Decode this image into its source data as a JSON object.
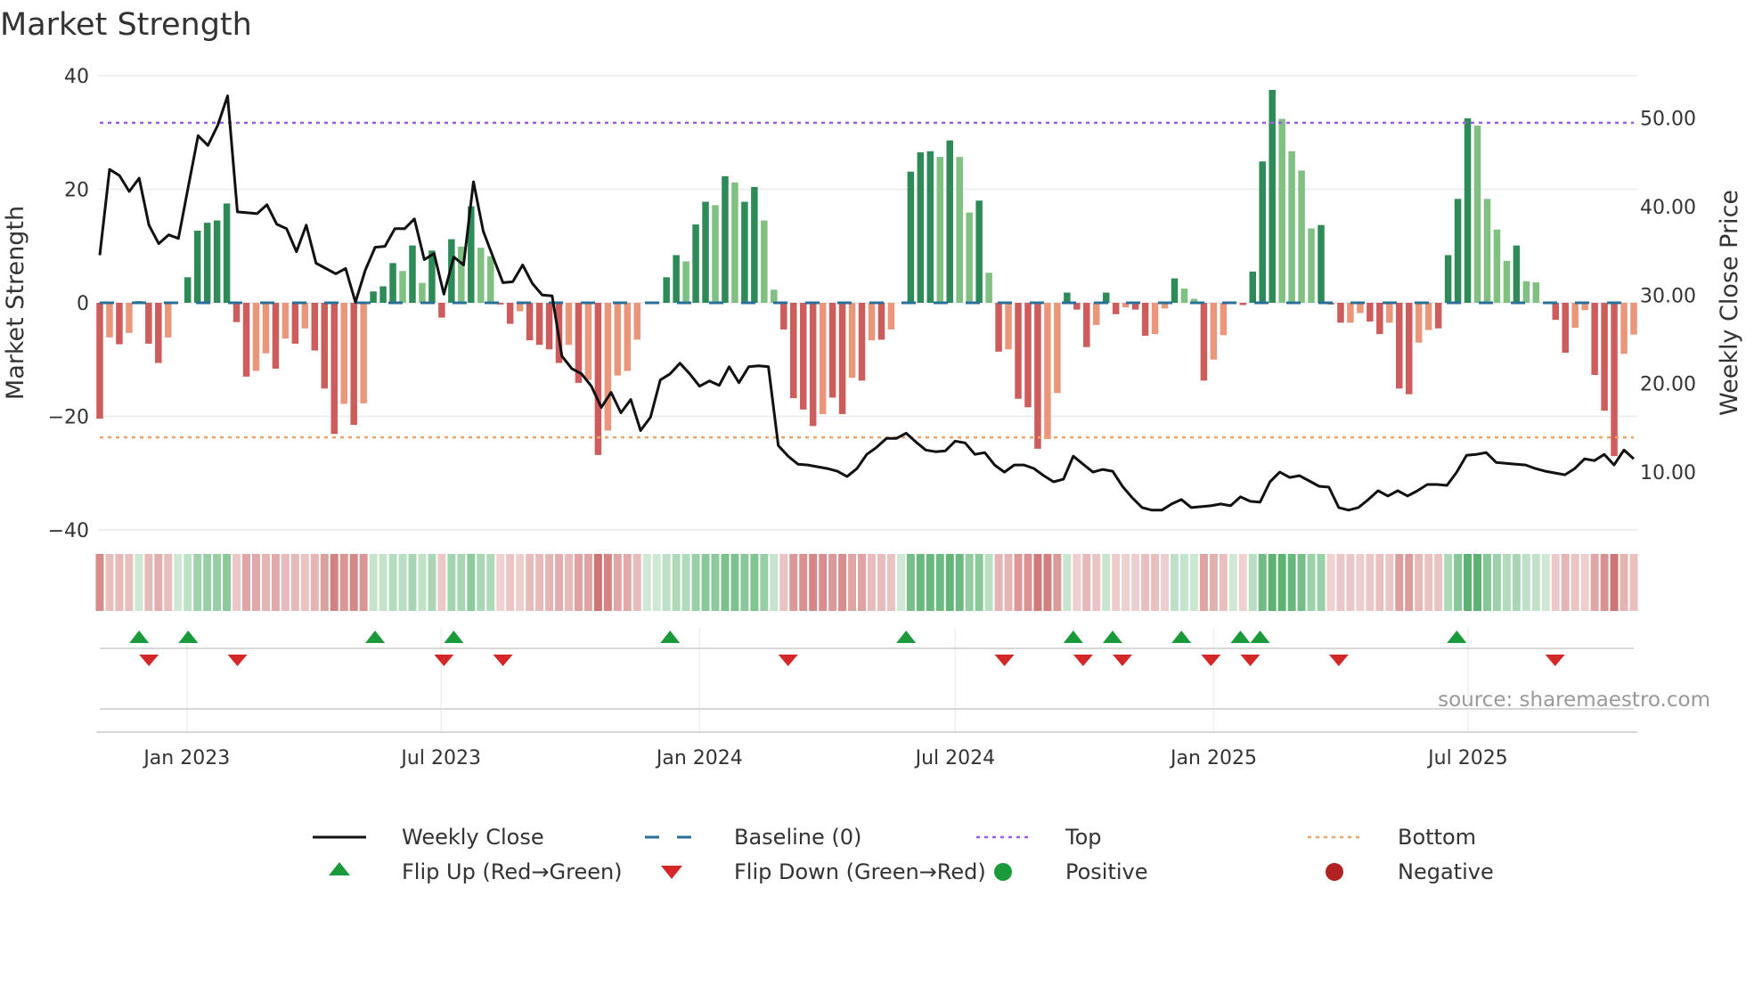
{
  "chart_data": {
    "type": "bar",
    "title": "Market Strength",
    "ylabel": "Market Strength",
    "y2label": "Weekly Close Price",
    "ylim": [
      -40,
      40
    ],
    "y2lim": [
      3.5,
      54.8
    ],
    "yticks": [
      40,
      20,
      0,
      -20,
      -40
    ],
    "ytick_labels": [
      "40",
      "20",
      "0",
      "−20",
      "−40"
    ],
    "y2ticks": [
      50,
      40,
      30,
      20,
      10
    ],
    "y2tick_labels": [
      "50.00",
      "40.00",
      "30.00",
      "20.00",
      "10.00"
    ],
    "xrange": [
      "2022-10-31",
      "2025-10-27"
    ],
    "xticks": [
      {
        "date": "2023-01-01",
        "label": "Jan 2023"
      },
      {
        "date": "2023-07-01",
        "label": "Jul 2023"
      },
      {
        "date": "2024-01-01",
        "label": "Jan 2024"
      },
      {
        "date": "2024-07-01",
        "label": "Jul 2024"
      },
      {
        "date": "2025-01-01",
        "label": "Jan 2025"
      },
      {
        "date": "2025-07-01",
        "label": "Jul 2025"
      }
    ],
    "grid": true,
    "thresholds": {
      "top": 31.7,
      "bottom": -23.7,
      "baseline": 0
    },
    "colors": {
      "pos_strong": "#2e8b57",
      "pos_weak": "#80c080",
      "neg_strong": "#cd5c5c",
      "neg_weak": "#e9967a",
      "baseline": "#2a6f97",
      "top": "#9b5de5",
      "bottom": "#f4a261",
      "line": "#111111",
      "flip_up": "#1a9a3a",
      "flip_down": "#d62728",
      "positive": "#1a9a3a",
      "negative": "#b22222"
    },
    "strength": [
      [
        -20.4,
        "s"
      ],
      [
        -6.1,
        "w"
      ],
      [
        -7.3,
        "s"
      ],
      [
        -5.3,
        "w"
      ],
      [
        0.3,
        "s"
      ],
      [
        -7.2,
        "s"
      ],
      [
        -10.6,
        "s"
      ],
      [
        -6.1,
        "w"
      ],
      [
        0,
        "s"
      ],
      [
        4.5,
        "s"
      ],
      [
        12.7,
        "s"
      ],
      [
        14.1,
        "s"
      ],
      [
        14.5,
        "s"
      ],
      [
        17.5,
        "s"
      ],
      [
        -3.4,
        "s"
      ],
      [
        -13,
        "s"
      ],
      [
        -12,
        "w"
      ],
      [
        -8.9,
        "w"
      ],
      [
        -11.6,
        "s"
      ],
      [
        -6.3,
        "w"
      ],
      [
        -7.2,
        "s"
      ],
      [
        -4.5,
        "w"
      ],
      [
        -8.4,
        "s"
      ],
      [
        -15.1,
        "s"
      ],
      [
        -23.1,
        "s"
      ],
      [
        -17.8,
        "w"
      ],
      [
        -21.5,
        "s"
      ],
      [
        -17.7,
        "w"
      ],
      [
        2,
        "s"
      ],
      [
        2.9,
        "s"
      ],
      [
        7,
        "s"
      ],
      [
        5.6,
        "w"
      ],
      [
        10.1,
        "s"
      ],
      [
        3.5,
        "w"
      ],
      [
        9.2,
        "s"
      ],
      [
        -2.6,
        "s"
      ],
      [
        11.2,
        "s"
      ],
      [
        9.9,
        "w"
      ],
      [
        17,
        "s"
      ],
      [
        9.7,
        "w"
      ],
      [
        8.2,
        "w"
      ],
      [
        -0.3,
        "s"
      ],
      [
        -3.7,
        "s"
      ],
      [
        -1.5,
        "w"
      ],
      [
        -6.6,
        "s"
      ],
      [
        -7.4,
        "s"
      ],
      [
        -8.2,
        "s"
      ],
      [
        -10.6,
        "s"
      ],
      [
        -7.4,
        "w"
      ],
      [
        -14.1,
        "s"
      ],
      [
        -13.6,
        "w"
      ],
      [
        -26.8,
        "s"
      ],
      [
        -22.5,
        "w"
      ],
      [
        -12.8,
        "w"
      ],
      [
        -12,
        "w"
      ],
      [
        -6.5,
        "w"
      ],
      [
        0,
        "s"
      ],
      [
        0,
        "s"
      ],
      [
        4.5,
        "s"
      ],
      [
        8.4,
        "s"
      ],
      [
        7.3,
        "w"
      ],
      [
        13.8,
        "s"
      ],
      [
        17.8,
        "s"
      ],
      [
        17.2,
        "w"
      ],
      [
        22.3,
        "s"
      ],
      [
        21.2,
        "w"
      ],
      [
        17.8,
        "s"
      ],
      [
        20.4,
        "s"
      ],
      [
        14.5,
        "w"
      ],
      [
        2.3,
        "w"
      ],
      [
        -4.7,
        "s"
      ],
      [
        -16.8,
        "s"
      ],
      [
        -18.8,
        "s"
      ],
      [
        -21.7,
        "s"
      ],
      [
        -19.6,
        "w"
      ],
      [
        -16.7,
        "s"
      ],
      [
        -19.6,
        "s"
      ],
      [
        -13.2,
        "w"
      ],
      [
        -13.7,
        "s"
      ],
      [
        -6.6,
        "w"
      ],
      [
        -6.5,
        "s"
      ],
      [
        -4.7,
        "w"
      ],
      [
        0,
        "s"
      ],
      [
        23.1,
        "s"
      ],
      [
        26.5,
        "s"
      ],
      [
        26.7,
        "s"
      ],
      [
        25.7,
        "w"
      ],
      [
        28.6,
        "s"
      ],
      [
        25.7,
        "w"
      ],
      [
        15.9,
        "w"
      ],
      [
        18,
        "s"
      ],
      [
        5.3,
        "w"
      ],
      [
        -8.6,
        "s"
      ],
      [
        -8.2,
        "w"
      ],
      [
        -16.9,
        "s"
      ],
      [
        -18.4,
        "s"
      ],
      [
        -25.7,
        "s"
      ],
      [
        -24,
        "w"
      ],
      [
        -15.9,
        "w"
      ],
      [
        1.8,
        "s"
      ],
      [
        -1.2,
        "s"
      ],
      [
        -7.8,
        "s"
      ],
      [
        -3.9,
        "w"
      ],
      [
        1.8,
        "s"
      ],
      [
        -2,
        "s"
      ],
      [
        -0.8,
        "w"
      ],
      [
        -1.2,
        "s"
      ],
      [
        -5.8,
        "s"
      ],
      [
        -5.5,
        "w"
      ],
      [
        -1,
        "w"
      ],
      [
        4.3,
        "s"
      ],
      [
        2.5,
        "w"
      ],
      [
        0.7,
        "w"
      ],
      [
        -13.7,
        "s"
      ],
      [
        -10,
        "w"
      ],
      [
        -5.7,
        "w"
      ],
      [
        0,
        "s"
      ],
      [
        -0.4,
        "s"
      ],
      [
        5.5,
        "s"
      ],
      [
        24.9,
        "s"
      ],
      [
        37.5,
        "s"
      ],
      [
        32.4,
        "w"
      ],
      [
        26.7,
        "w"
      ],
      [
        23.3,
        "w"
      ],
      [
        13.1,
        "w"
      ],
      [
        13.7,
        "s"
      ],
      [
        -0.3,
        "s"
      ],
      [
        -3.5,
        "s"
      ],
      [
        -3.5,
        "w"
      ],
      [
        -1.8,
        "w"
      ],
      [
        -3.3,
        "s"
      ],
      [
        -5.5,
        "s"
      ],
      [
        -3.5,
        "w"
      ],
      [
        -15.1,
        "s"
      ],
      [
        -16.1,
        "s"
      ],
      [
        -7,
        "w"
      ],
      [
        -4.8,
        "w"
      ],
      [
        -4.5,
        "s"
      ],
      [
        8.4,
        "s"
      ],
      [
        18.3,
        "s"
      ],
      [
        32.5,
        "s"
      ],
      [
        31.2,
        "w"
      ],
      [
        18.3,
        "w"
      ],
      [
        12.9,
        "w"
      ],
      [
        7.4,
        "w"
      ],
      [
        10.1,
        "s"
      ],
      [
        3.8,
        "w"
      ],
      [
        3.6,
        "w"
      ],
      [
        0,
        "s"
      ],
      [
        -3,
        "s"
      ],
      [
        -8.8,
        "s"
      ],
      [
        -4.4,
        "w"
      ],
      [
        -1.3,
        "w"
      ],
      [
        -12.7,
        "s"
      ],
      [
        -19,
        "s"
      ],
      [
        -27,
        "s"
      ],
      [
        -9,
        "w"
      ],
      [
        -5.6,
        "w"
      ]
    ],
    "weekly_close": [
      34.5,
      44.2,
      43.5,
      41.7,
      43.2,
      37.9,
      35.8,
      36.8,
      36.4,
      42.2,
      48,
      46.9,
      49.2,
      52.5,
      39.4,
      39.3,
      39.2,
      40.2,
      38,
      37.5,
      34.9,
      37.9,
      33.6,
      33,
      32.4,
      33,
      29.2,
      32.8,
      35.4,
      35.5,
      37.5,
      37.5,
      38.6,
      34,
      34.7,
      30.1,
      34.3,
      33.4,
      42.8,
      37.2,
      34.3,
      31.4,
      31.5,
      33.4,
      31.3,
      30,
      29.9,
      23.1,
      21.7,
      21.1,
      19.7,
      17.3,
      19,
      16.7,
      18.2,
      14.7,
      16.2,
      20.4,
      21.1,
      22.3,
      21.1,
      19.7,
      20.3,
      19.8,
      21.9,
      20.1,
      21.9,
      22,
      21.9,
      13,
      11.8,
      10.9,
      10.8,
      10.6,
      10.4,
      10.1,
      9.5,
      10.4,
      12,
      12.8,
      13.8,
      13.8,
      14.4,
      13.4,
      12.5,
      12.3,
      12.4,
      13.5,
      13.3,
      12,
      12.2,
      10.8,
      10,
      10.8,
      10.8,
      10.4,
      9.6,
      8.9,
      9.2,
      11.8,
      10.9,
      10,
      10.3,
      10.1,
      8.4,
      7.1,
      6,
      5.7,
      5.7,
      6.4,
      6.9,
      6,
      6.1,
      6.2,
      6.4,
      6.2,
      7.2,
      6.7,
      6.6,
      8.9,
      10,
      9.4,
      9.6,
      9,
      8.4,
      8.3,
      6,
      5.7,
      6,
      6.9,
      7.9,
      7.3,
      7.9,
      7.3,
      7.9,
      8.6,
      8.6,
      8.5,
      10,
      11.9,
      12,
      12.2,
      11.1,
      11,
      10.9,
      10.8,
      10.4,
      10.1,
      9.9,
      9.7,
      10.4,
      11.5,
      11.3,
      12,
      10.8,
      12.5,
      11.5
    ],
    "flip_up_dates": [
      "2022-11-28",
      "2023-01-02",
      "2023-05-15",
      "2023-07-10",
      "2023-12-11",
      "2024-05-27",
      "2024-09-23",
      "2024-10-21",
      "2024-12-09",
      "2025-01-20",
      "2025-02-03",
      "2025-06-23"
    ],
    "flip_down_dates": [
      "2022-12-05",
      "2023-02-06",
      "2023-07-03",
      "2023-08-14",
      "2024-03-04",
      "2024-08-05",
      "2024-09-30",
      "2024-10-28",
      "2024-12-30",
      "2025-01-27",
      "2025-03-31",
      "2025-09-01"
    ],
    "legend": {
      "placement": "bottom",
      "items": [
        {
          "label": "Weekly Close",
          "symbol": "line"
        },
        {
          "label": "Baseline (0)",
          "symbol": "dash"
        },
        {
          "label": "Top",
          "symbol": "dot-purple"
        },
        {
          "label": "Bottom",
          "symbol": "dot-orange"
        },
        {
          "label": "Flip Up (Red→Green)",
          "symbol": "tri-up"
        },
        {
          "label": "Flip Down (Green→Red)",
          "symbol": "tri-down"
        },
        {
          "label": "Positive",
          "symbol": "circle-green"
        },
        {
          "label": "Negative",
          "symbol": "circle-red"
        }
      ]
    },
    "annotation": "source: sharemaestro.com"
  }
}
